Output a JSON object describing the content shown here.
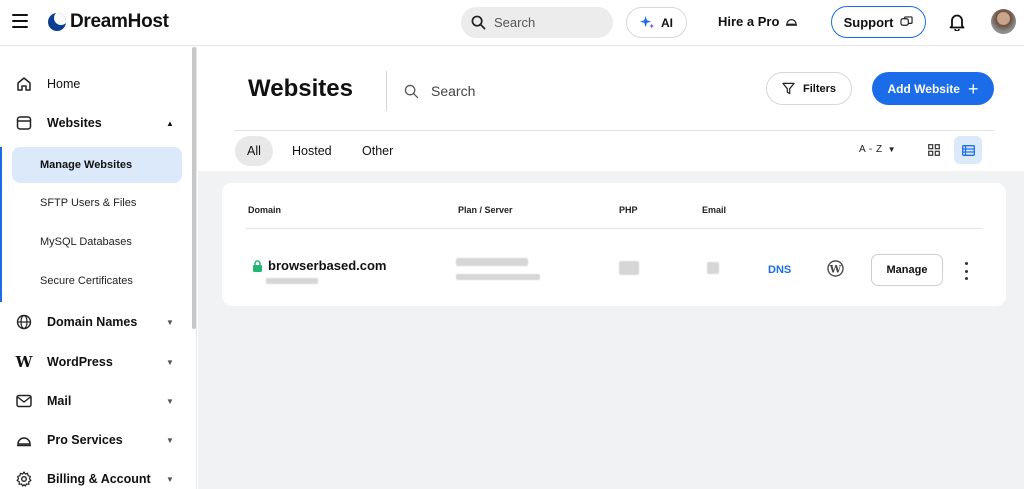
{
  "header": {
    "brand": "DreamHost",
    "search_placeholder": "Search",
    "ai_label": "AI",
    "hire_label": "Hire a Pro",
    "support_label": "Support"
  },
  "sidebar": {
    "items": [
      {
        "label": "Home",
        "icon": "home-icon"
      },
      {
        "label": "Websites",
        "icon": "websites-icon",
        "expanded": true
      },
      {
        "label": "Domain Names",
        "icon": "globe-icon"
      },
      {
        "label": "WordPress",
        "icon": "wordpress-logo-icon"
      },
      {
        "label": "Mail",
        "icon": "mail-icon"
      },
      {
        "label": "Pro Services",
        "icon": "pro-services-icon"
      },
      {
        "label": "Billing & Account",
        "icon": "gear-icon"
      }
    ],
    "websites_sub": [
      "Manage Websites",
      "SFTP Users & Files",
      "MySQL Databases",
      "Secure Certificates"
    ],
    "active_sub": "Manage Websites"
  },
  "main": {
    "title": "Websites",
    "search_placeholder": "Search",
    "filters_label": "Filters",
    "add_label": "Add Website",
    "tabs": [
      "All",
      "Hosted",
      "Other"
    ],
    "active_tab": "All",
    "sort_label": "A - Z",
    "view_mode": "list"
  },
  "table": {
    "columns": [
      "Domain",
      "Plan / Server",
      "PHP",
      "Email"
    ],
    "rows": [
      {
        "domain": "browserbased.com",
        "dns_label": "DNS",
        "manage_label": "Manage"
      }
    ]
  },
  "colors": {
    "accent": "#1b6ce8",
    "active_bg": "#dbe9fb",
    "secure_green": "#22b573"
  }
}
